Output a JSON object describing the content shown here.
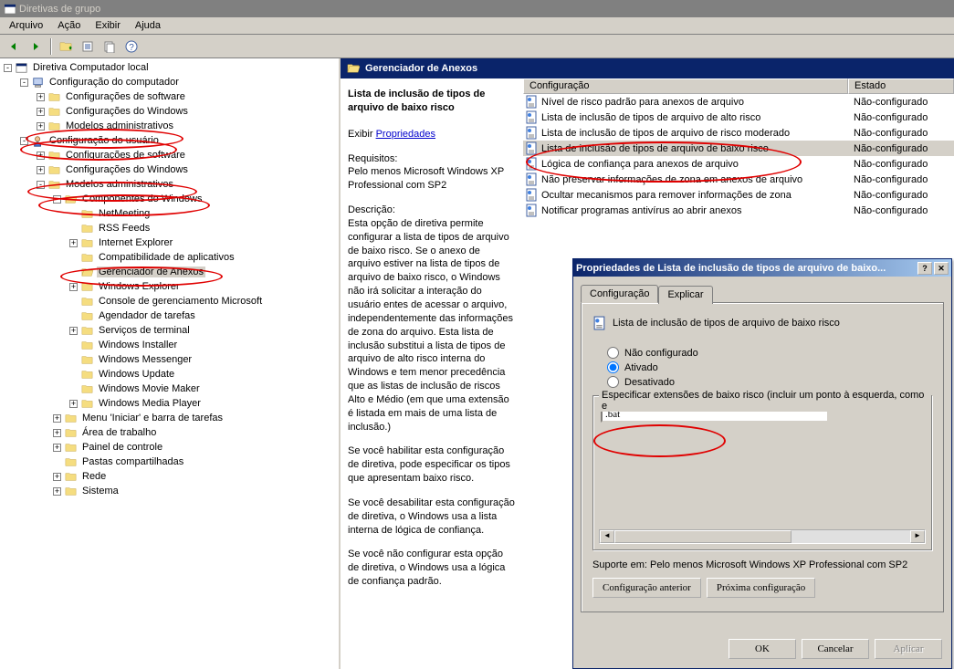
{
  "window": {
    "title": "Diretivas de grupo"
  },
  "menu": {
    "items": [
      "Arquivo",
      "Ação",
      "Exibir",
      "Ajuda"
    ]
  },
  "tree": [
    {
      "level": 0,
      "exp": "-",
      "icon": "console",
      "label": "Diretiva Computador local"
    },
    {
      "level": 1,
      "exp": "-",
      "icon": "computer",
      "label": "Configuração do computador"
    },
    {
      "level": 2,
      "exp": "+",
      "icon": "folder",
      "label": "Configurações de software"
    },
    {
      "level": 2,
      "exp": "+",
      "icon": "folder",
      "label": "Configurações do Windows"
    },
    {
      "level": 2,
      "exp": "+",
      "icon": "folder",
      "label": "Modelos administrativos",
      "circled": true
    },
    {
      "level": 1,
      "exp": "-",
      "icon": "user",
      "label": "Configuração do usuário",
      "circled": true
    },
    {
      "level": 2,
      "exp": "+",
      "icon": "folder",
      "label": "Configurações de software"
    },
    {
      "level": 2,
      "exp": "+",
      "icon": "folder",
      "label": "Configurações do Windows"
    },
    {
      "level": 2,
      "exp": "-",
      "icon": "folder",
      "label": "Modelos administrativos",
      "circled": true
    },
    {
      "level": 3,
      "exp": "-",
      "icon": "folder-open",
      "label": "Componentes do Windows",
      "circled": true
    },
    {
      "level": 4,
      "exp": "",
      "icon": "folder",
      "label": "NetMeeting"
    },
    {
      "level": 4,
      "exp": "",
      "icon": "folder",
      "label": "RSS Feeds"
    },
    {
      "level": 4,
      "exp": "+",
      "icon": "folder",
      "label": "Internet Explorer"
    },
    {
      "level": 4,
      "exp": "",
      "icon": "folder",
      "label": "Compatibilidade de aplicativos"
    },
    {
      "level": 4,
      "exp": "",
      "icon": "folder-open",
      "label": "Gerenciador de Anexos",
      "selected": true,
      "circled": true
    },
    {
      "level": 4,
      "exp": "+",
      "icon": "folder",
      "label": "Windows Explorer"
    },
    {
      "level": 4,
      "exp": "",
      "icon": "folder",
      "label": "Console de gerenciamento Microsoft"
    },
    {
      "level": 4,
      "exp": "",
      "icon": "folder",
      "label": "Agendador de tarefas"
    },
    {
      "level": 4,
      "exp": "+",
      "icon": "folder",
      "label": "Serviços de terminal"
    },
    {
      "level": 4,
      "exp": "",
      "icon": "folder",
      "label": "Windows Installer"
    },
    {
      "level": 4,
      "exp": "",
      "icon": "folder",
      "label": "Windows Messenger"
    },
    {
      "level": 4,
      "exp": "",
      "icon": "folder",
      "label": "Windows Update"
    },
    {
      "level": 4,
      "exp": "",
      "icon": "folder",
      "label": "Windows Movie Maker"
    },
    {
      "level": 4,
      "exp": "+",
      "icon": "folder",
      "label": "Windows Media Player"
    },
    {
      "level": 3,
      "exp": "+",
      "icon": "folder",
      "label": "Menu 'Iniciar' e barra de tarefas"
    },
    {
      "level": 3,
      "exp": "+",
      "icon": "folder",
      "label": "Área de trabalho"
    },
    {
      "level": 3,
      "exp": "+",
      "icon": "folder",
      "label": "Painel de controle"
    },
    {
      "level": 3,
      "exp": "",
      "icon": "folder",
      "label": "Pastas compartilhadas"
    },
    {
      "level": 3,
      "exp": "+",
      "icon": "folder",
      "label": "Rede"
    },
    {
      "level": 3,
      "exp": "+",
      "icon": "folder",
      "label": "Sistema"
    }
  ],
  "header": {
    "title": "Gerenciador de Anexos"
  },
  "detail": {
    "title": "Lista de inclusão de tipos de arquivo de baixo risco",
    "exibir": "Exibir",
    "propriedades": "Propriedades",
    "requisitos_label": "Requisitos:",
    "requisitos_value": "Pelo menos Microsoft Windows XP Professional com SP2",
    "descricao_label": "Descrição:",
    "descricao_p1": "Esta opção de diretiva permite configurar a lista de tipos de arquivo de baixo risco. Se o anexo de arquivo estiver na lista de tipos de arquivo de baixo risco, o Windows não irá solicitar a interação do usuário entes de acessar o arquivo, independentemente das informações de zona do arquivo. Esta lista de inclusão substitui a lista de tipos de arquivo de alto risco interna do Windows e tem menor precedência que as listas de inclusão de riscos Alto e Médio (em que uma extensão é listada em mais de uma lista de inclusão.)",
    "descricao_p2": "Se você habilitar esta configuração de diretiva, pode especificar os tipos que apresentam baixo risco.",
    "descricao_p3": "Se você desabilitar esta configuração de diretiva, o Windows usa a lista interna de lógica de confiança.",
    "descricao_p4": "Se você não configurar esta opção de diretiva, o Windows usa a lógica de confiança padrão."
  },
  "list": {
    "col_config": "Configuração",
    "col_estado": "Estado",
    "rows": [
      {
        "label": "Nível de risco padrão para anexos de arquivo",
        "state": "Não-configurado"
      },
      {
        "label": "Lista de inclusão de tipos de arquivo de alto risco",
        "state": "Não-configurado"
      },
      {
        "label": "Lista de inclusão de tipos de arquivo de risco moderado",
        "state": "Não-configurado",
        "circled": true
      },
      {
        "label": "Lista de inclusão de tipos de arquivo de baixo risco",
        "state": "Não-configurado",
        "selected": true,
        "circled": true
      },
      {
        "label": "Lógica de confiança para anexos de arquivo",
        "state": "Não-configurado"
      },
      {
        "label": "Não preservar informações de zona em anexos de arquivo",
        "state": "Não-configurado"
      },
      {
        "label": "Ocultar mecanismos para remover informações de zona",
        "state": "Não-configurado"
      },
      {
        "label": "Notificar programas antivírus ao abrir anexos",
        "state": "Não-configurado"
      }
    ]
  },
  "dialog": {
    "title": "Propriedades de Lista de inclusão de tipos de arquivo de baixo...",
    "tab_config": "Configuração",
    "tab_explain": "Explicar",
    "policy_name": "Lista de inclusão de tipos de arquivo de baixo risco",
    "radio_notconfigured": "Não configurado",
    "radio_enabled": "Ativado",
    "radio_disabled": "Desativado",
    "selected_radio": "enabled",
    "fieldset_legend": "Especificar extensões de baixo risco (incluir um ponto à esquerda, como e",
    "input_value": ".bat",
    "support": "Suporte em:  Pelo menos Microsoft Windows XP Professional com SP2",
    "btn_prev": "Configuração anterior",
    "btn_next": "Próxima configuração",
    "btn_ok": "OK",
    "btn_cancel": "Cancelar",
    "btn_apply": "Aplicar"
  }
}
